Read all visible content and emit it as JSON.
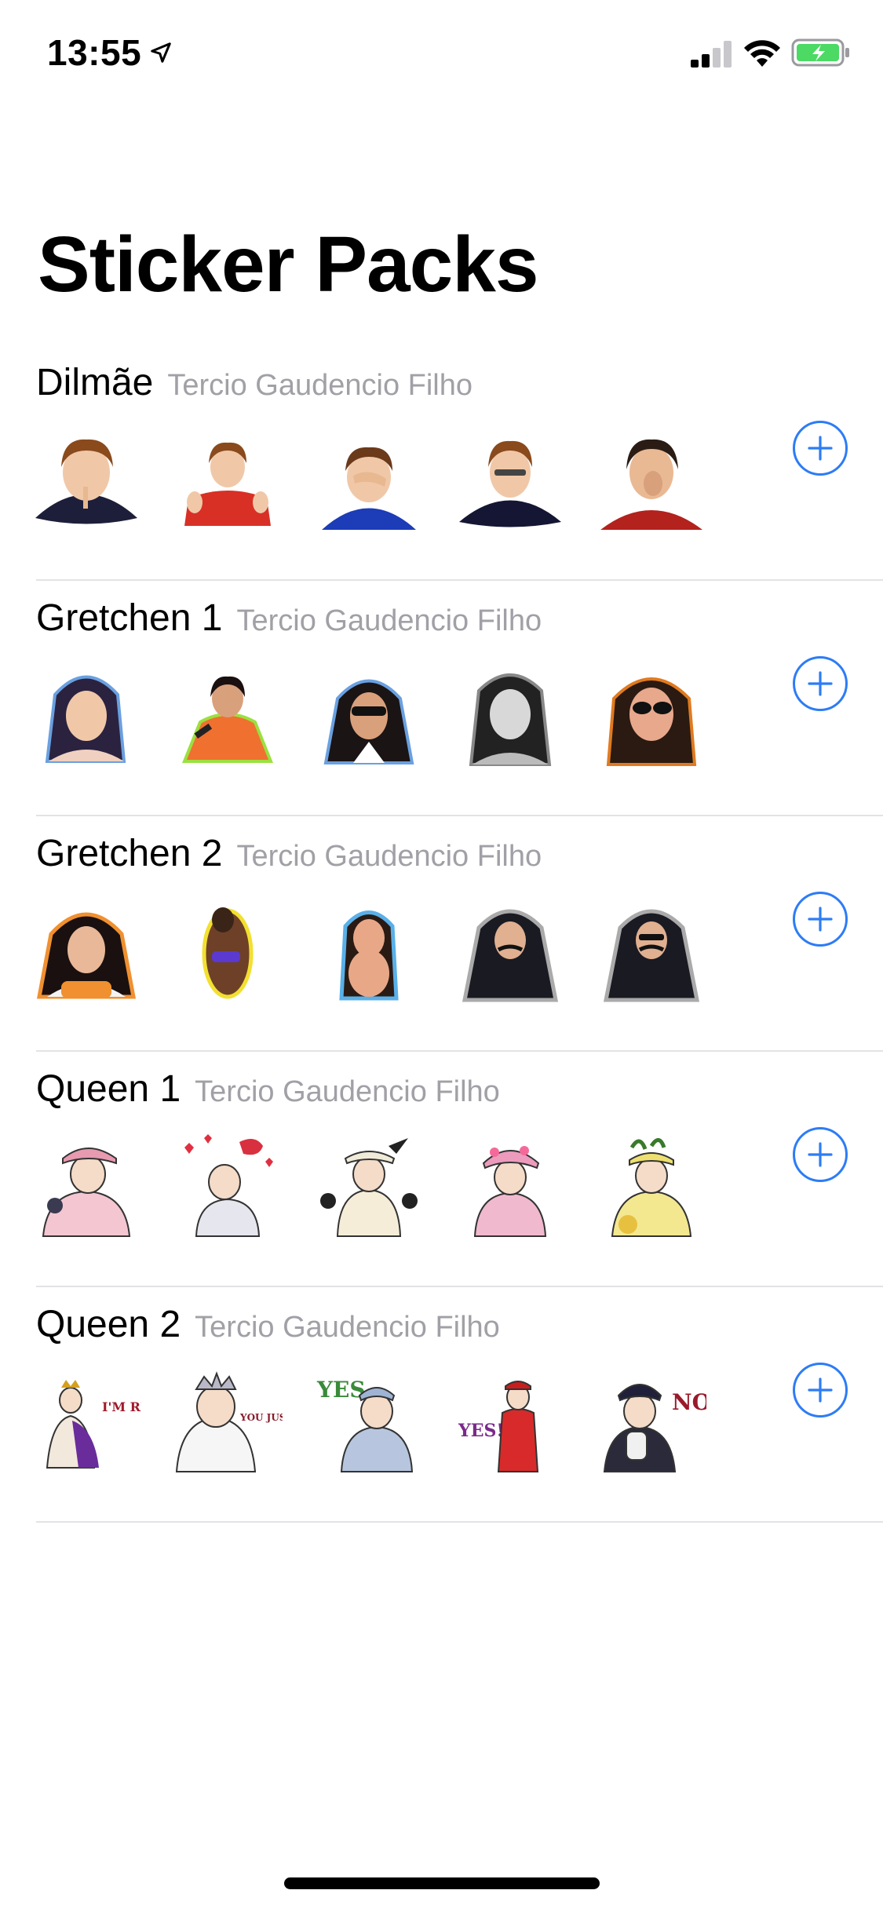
{
  "status_bar": {
    "time": "13:55",
    "icons": [
      "location-arrow-icon",
      "cellular-signal-icon",
      "wifi-icon",
      "battery-charging-icon"
    ]
  },
  "title": "Sticker Packs",
  "packs": [
    {
      "name": "Dilmãe",
      "author": "Tercio Gaudencio Filho"
    },
    {
      "name": "Gretchen 1",
      "author": "Tercio Gaudencio Filho"
    },
    {
      "name": "Gretchen 2",
      "author": "Tercio Gaudencio Filho"
    },
    {
      "name": "Queen 1",
      "author": "Tercio Gaudencio Filho"
    },
    {
      "name": "Queen 2",
      "author": "Tercio Gaudencio Filho",
      "sticker_texts": [
        "I'M READY",
        "YOU JUST KEEP CALM",
        "YES",
        "YES!",
        "NO"
      ]
    }
  ],
  "colors": {
    "accent": "#2d7cf6",
    "separator": "#e3e3e6",
    "secondary_text": "#a0a0a6",
    "battery_charging": "#4cd964"
  },
  "icons": {
    "add": "plus-circle-icon"
  }
}
